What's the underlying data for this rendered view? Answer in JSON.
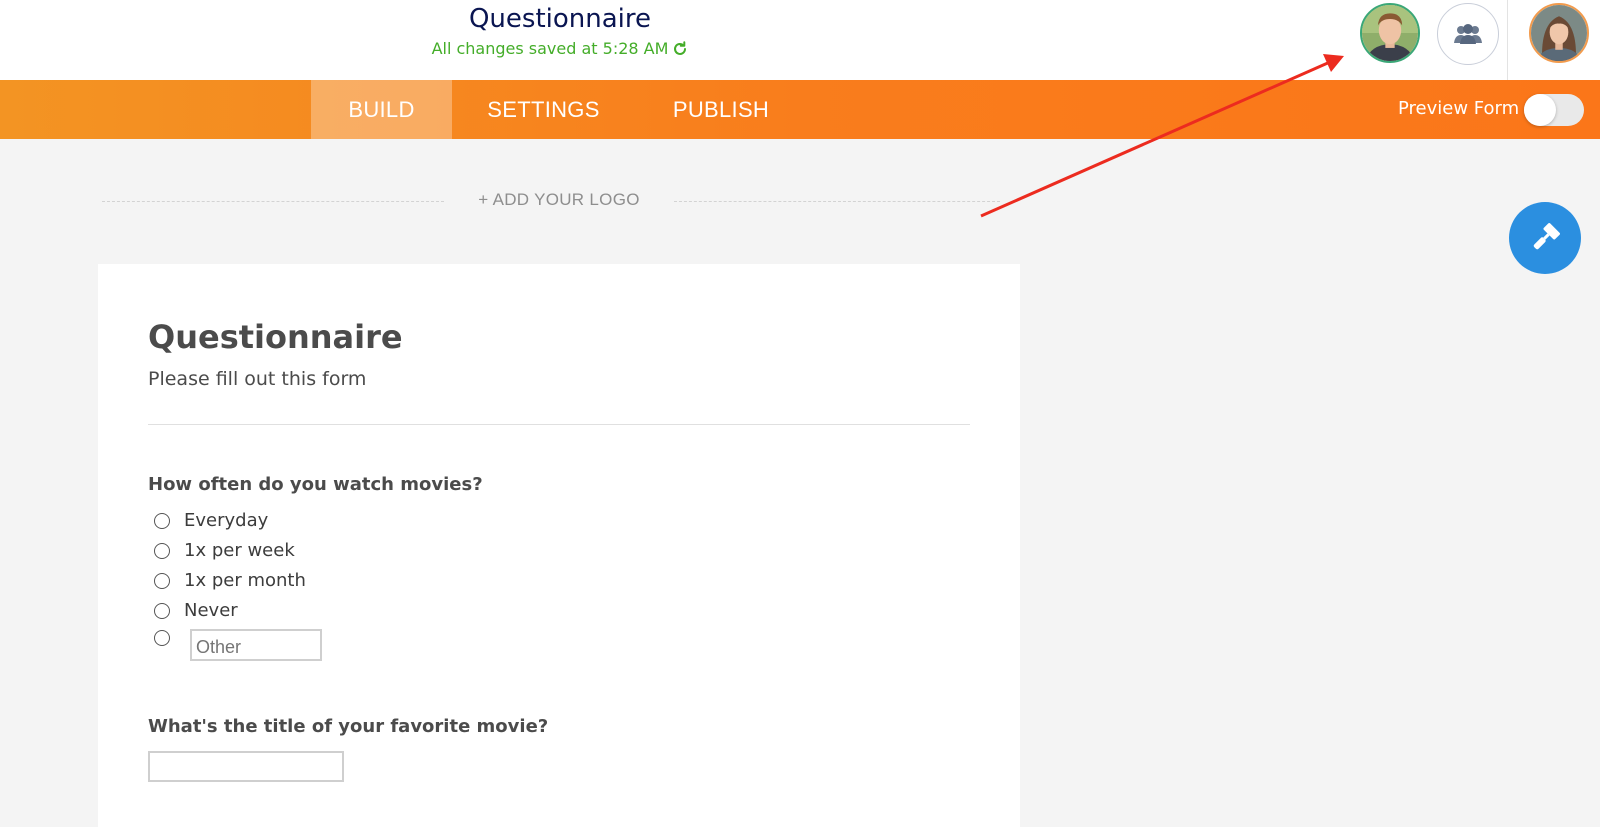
{
  "header": {
    "title": "Questionnaire",
    "save_status": "All changes saved at 5:28 AM",
    "status_color": "#44ad29"
  },
  "nav": {
    "tabs": [
      {
        "label": "BUILD",
        "active": true
      },
      {
        "label": "SETTINGS",
        "active": false
      },
      {
        "label": "PUBLISH",
        "active": false
      }
    ],
    "preview_label": "Preview Form",
    "preview_on": false,
    "accent": "#f97d1c"
  },
  "logo": {
    "add_label": "+ ADD YOUR LOGO"
  },
  "icons": [
    "refresh-icon",
    "user-avatar",
    "collaborators-icon",
    "paint-roller-icon"
  ],
  "form": {
    "title": "Questionnaire",
    "subtitle": "Please fill out this form",
    "questions": [
      {
        "label": "How often do you watch movies?",
        "options": [
          "Everyday",
          "1x per week",
          "1x per month",
          "Never"
        ],
        "other_placeholder": "Other"
      },
      {
        "label": "What's the title of your favorite movie?",
        "value": ""
      }
    ]
  }
}
